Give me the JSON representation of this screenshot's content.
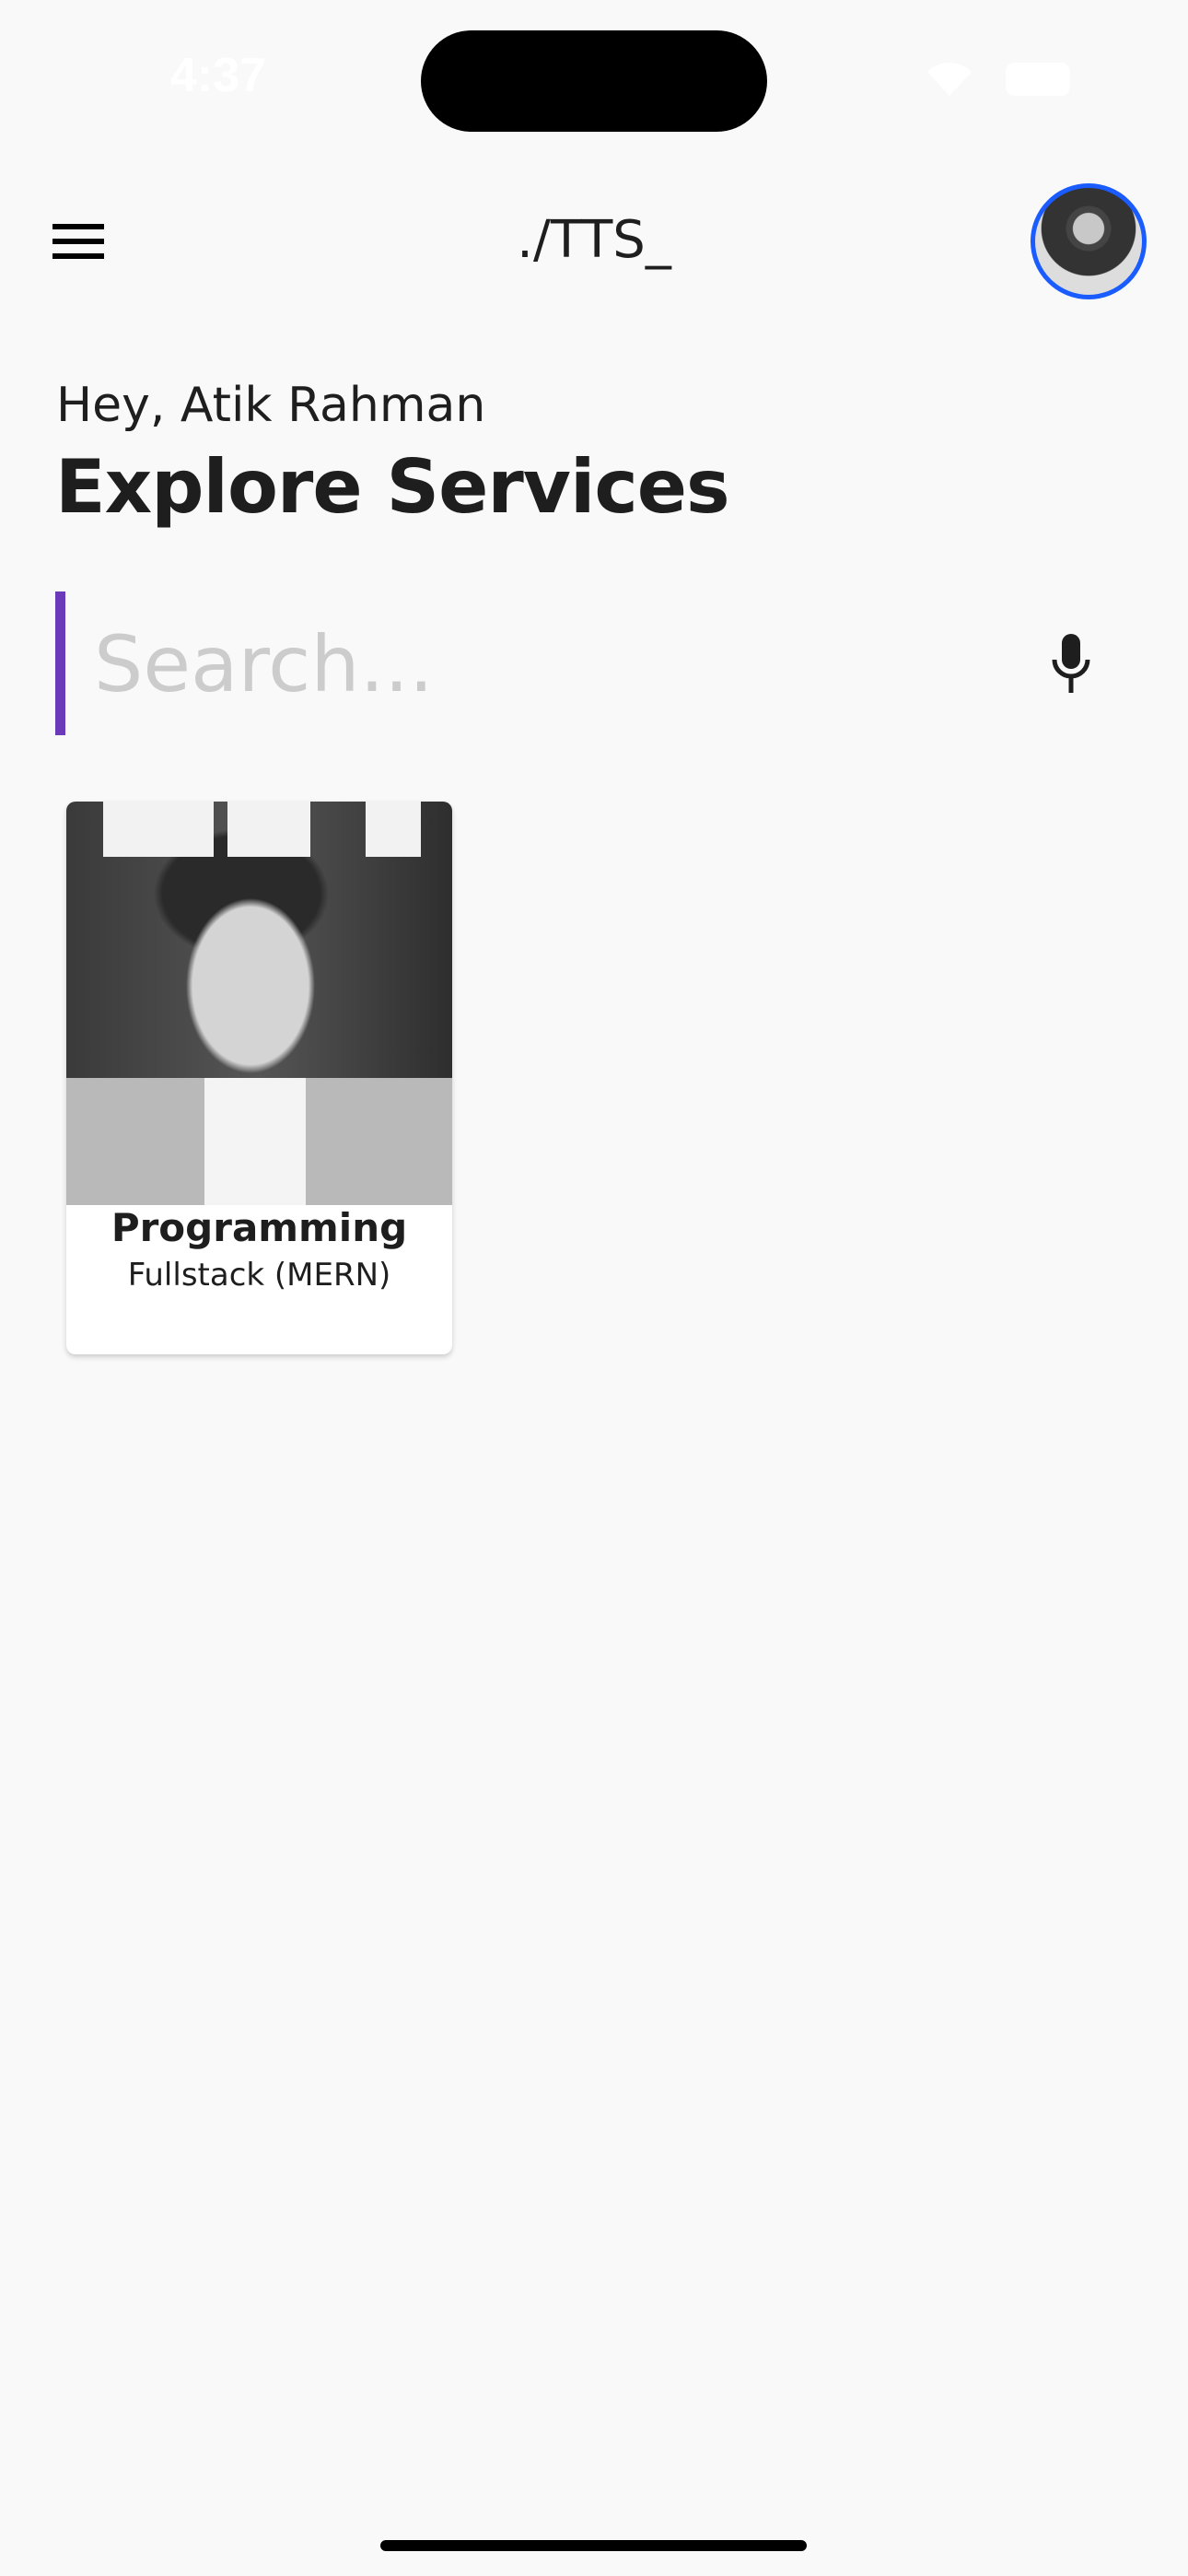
{
  "status_bar": {
    "time": "4:37"
  },
  "header": {
    "title": "./TTS_",
    "menu_icon": "hamburger-menu-icon",
    "avatar_icon": "profile-avatar",
    "accent_color": "#1a5cff"
  },
  "greeting": "Hey, Atik Rahman",
  "page_title": "Explore Services",
  "search": {
    "placeholder": "Search...",
    "value": "",
    "accent_color": "#6a3ab8",
    "mic_icon": "microphone-icon"
  },
  "services": [
    {
      "title": "Programming",
      "subtitle": "Fullstack (MERN)"
    }
  ]
}
